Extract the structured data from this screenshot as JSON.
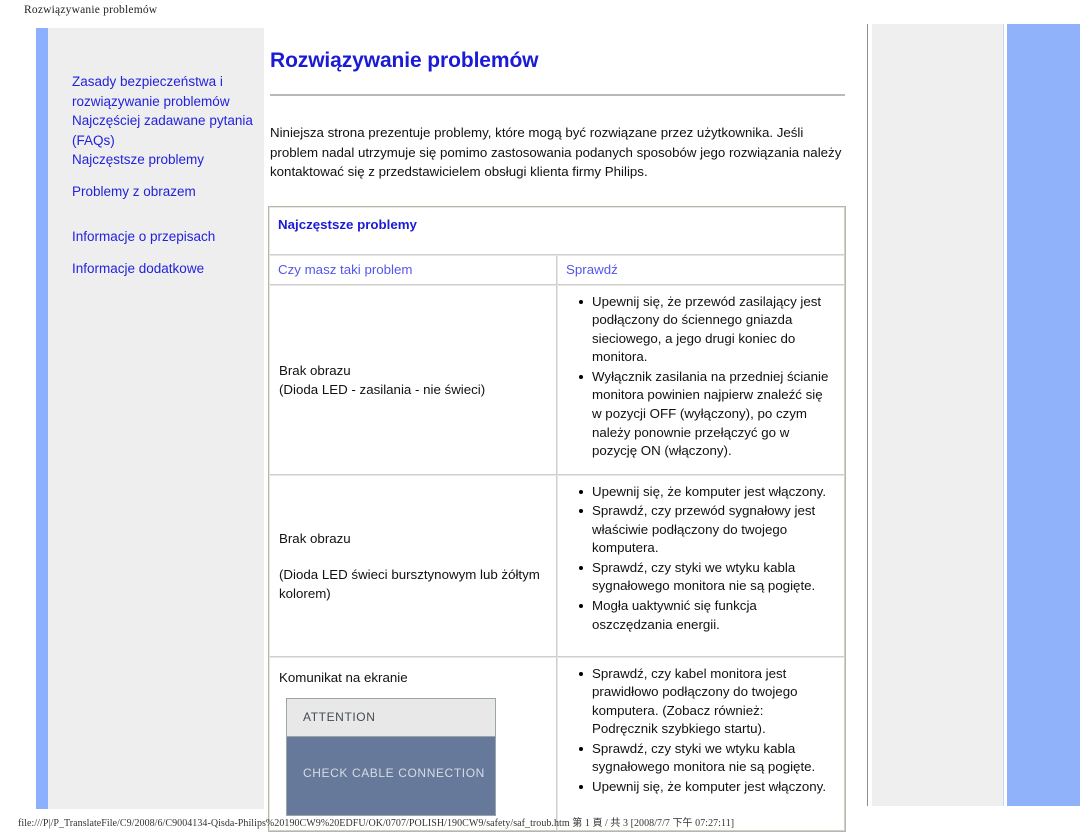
{
  "print": {
    "header": "Rozwiązywanie problemów",
    "footer": "file:///P|/P_TranslateFile/C9/2008/6/C9004134-Qisda-Philips%20190CW9%20EDFU/OK/0707/POLISH/190CW9/safety/saf_troub.htm 第 1 頁 / 共 3 [2008/7/7 下午 07:27:11]"
  },
  "colors": {
    "link": "#2222dd",
    "heading": "#1b1bd6",
    "col_head": "#5555ee",
    "accent_bar": "#8ab0ff",
    "right_bar": "#8fb2fb",
    "osd_body": "#66799a",
    "osd_top": "#e8e8e8"
  },
  "sidebar": {
    "items": [
      {
        "label": "Zasady bezpieczeństwa i rozwiązywanie problemów"
      },
      {
        "label": "Najczęściej zadawane pytania (FAQs)"
      },
      {
        "label": "Najczęstsze problemy"
      },
      {
        "label": "Problemy z obrazem"
      },
      {
        "label": "Informacje o przepisach"
      },
      {
        "label": "Informacje dodatkowe"
      }
    ]
  },
  "main": {
    "title": "Rozwiązywanie problemów",
    "intro": "Niniejsza strona prezentuje problemy, które mogą być rozwiązane przez użytkownika. Jeśli problem nadal utrzymuje się pomimo zastosowania podanych sposobów jego rozwiązania należy kontaktować się z przedstawicielem obsługi klienta firmy Philips.",
    "table": {
      "section_title": "Najczęstsze problemy",
      "col_problem": "Czy masz taki problem",
      "col_check": "Sprawdź",
      "rows": [
        {
          "problem_line1": "Brak obrazu",
          "problem_line2": "(Dioda LED - zasilania - nie świeci)",
          "checks": [
            "Upewnij się, że przewód zasilający jest podłączony do ściennego gniazda sieciowego, a jego drugi koniec do monitora.",
            "Wyłącznik zasilania na przedniej ścianie monitora powinien najpierw znaleźć się w pozycji OFF (wyłączony), po czym należy ponownie przełączyć go w pozycję ON (włączony)."
          ]
        },
        {
          "problem_line1": "Brak obrazu",
          "problem_line2": "(Dioda LED świeci bursztynowym lub żółtym kolorem)",
          "checks": [
            "Upewnij się, że komputer jest włączony.",
            "Sprawdź, czy przewód sygnałowy jest właściwie podłączony do twojego komputera.",
            "Sprawdź, czy styki we wtyku kabla sygnałowego monitora nie są pogięte.",
            "Mogła uaktywnić się funkcja oszczędzania energii."
          ]
        },
        {
          "problem_line1": "Komunikat na ekranie",
          "osd": {
            "top": "ATTENTION",
            "body": "CHECK CABLE CONNECTION"
          },
          "checks": [
            "Sprawdź, czy kabel monitora jest prawidłowo podłączony do twojego komputera. (Zobacz również: Podręcznik szybkiego startu).",
            "Sprawdź, czy styki we wtyku kabla sygnałowego monitora nie są pogięte.",
            "Upewnij się, że komputer jest włączony."
          ]
        }
      ]
    }
  }
}
